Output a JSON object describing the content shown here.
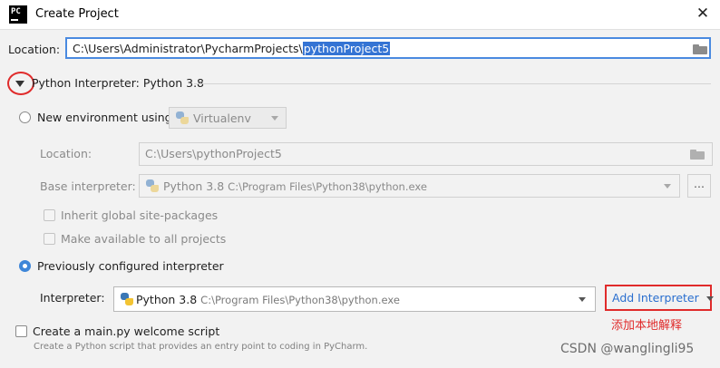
{
  "window": {
    "title": "Create Project",
    "app_icon_text": "PC"
  },
  "location": {
    "label": "Location:",
    "path_prefix": "C:\\Users\\Administrator\\PycharmProjects\\",
    "path_selected": "pythonProject5"
  },
  "interpreter_section": {
    "title": "Python Interpreter: Python 3.8"
  },
  "new_env": {
    "radio_label": "New environment using",
    "tool": "Virtualenv",
    "location_label": "Location:",
    "location_value": "C:\\Users\\pythonProject5",
    "base_label": "Base interpreter:",
    "base_name": "Python 3.8",
    "base_path": "C:\\Program Files\\Python38\\python.exe",
    "browse_label": "...",
    "inherit_label": "Inherit global site-packages",
    "available_label": "Make available to all projects"
  },
  "existing": {
    "radio_label": "Previously configured interpreter",
    "interpreter_label": "Interpreter:",
    "interpreter_name": "Python 3.8",
    "interpreter_path": "C:\\Program Files\\Python38\\python.exe",
    "add_button": "Add Interpreter",
    "annotation": "添加本地解释"
  },
  "welcome": {
    "checkbox_label": "Create a main.py welcome script",
    "description": "Create a Python script that provides an entry point to coding in PyCharm."
  },
  "watermark": "CSDN @wanglingli95",
  "colors": {
    "accent": "#3574d4",
    "annotation_red": "#e02b2b"
  }
}
